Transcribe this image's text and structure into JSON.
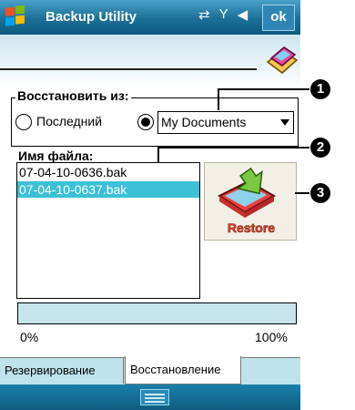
{
  "titlebar": {
    "app_title": "Backup Utility",
    "ok_label": "ok",
    "icons": [
      "windows-start-flag-icon",
      "connectivity-icon",
      "signal-icon",
      "volume-icon"
    ]
  },
  "restore_from": {
    "title": "Восстановить из:",
    "option_last": "Последний",
    "option_selected": "folder",
    "combo_value": "My Documents"
  },
  "file_list": {
    "label": "Имя файла:",
    "items": [
      "07-04-10-0636.bak",
      "07-04-10-0637.bak"
    ],
    "selected_index": 1
  },
  "restore_button": {
    "label": "Restore"
  },
  "progress": {
    "min_label": "0%",
    "max_label": "100%",
    "value": 0
  },
  "tabs": [
    {
      "label": "Резервирование",
      "active": false
    },
    {
      "label": "Восстановление",
      "active": true
    }
  ],
  "callouts": [
    "1",
    "2",
    "3"
  ],
  "colors": {
    "title_bar": "#1b6f97",
    "selection": "#3cc0d6",
    "tab_bar": "#bfe3ec"
  }
}
